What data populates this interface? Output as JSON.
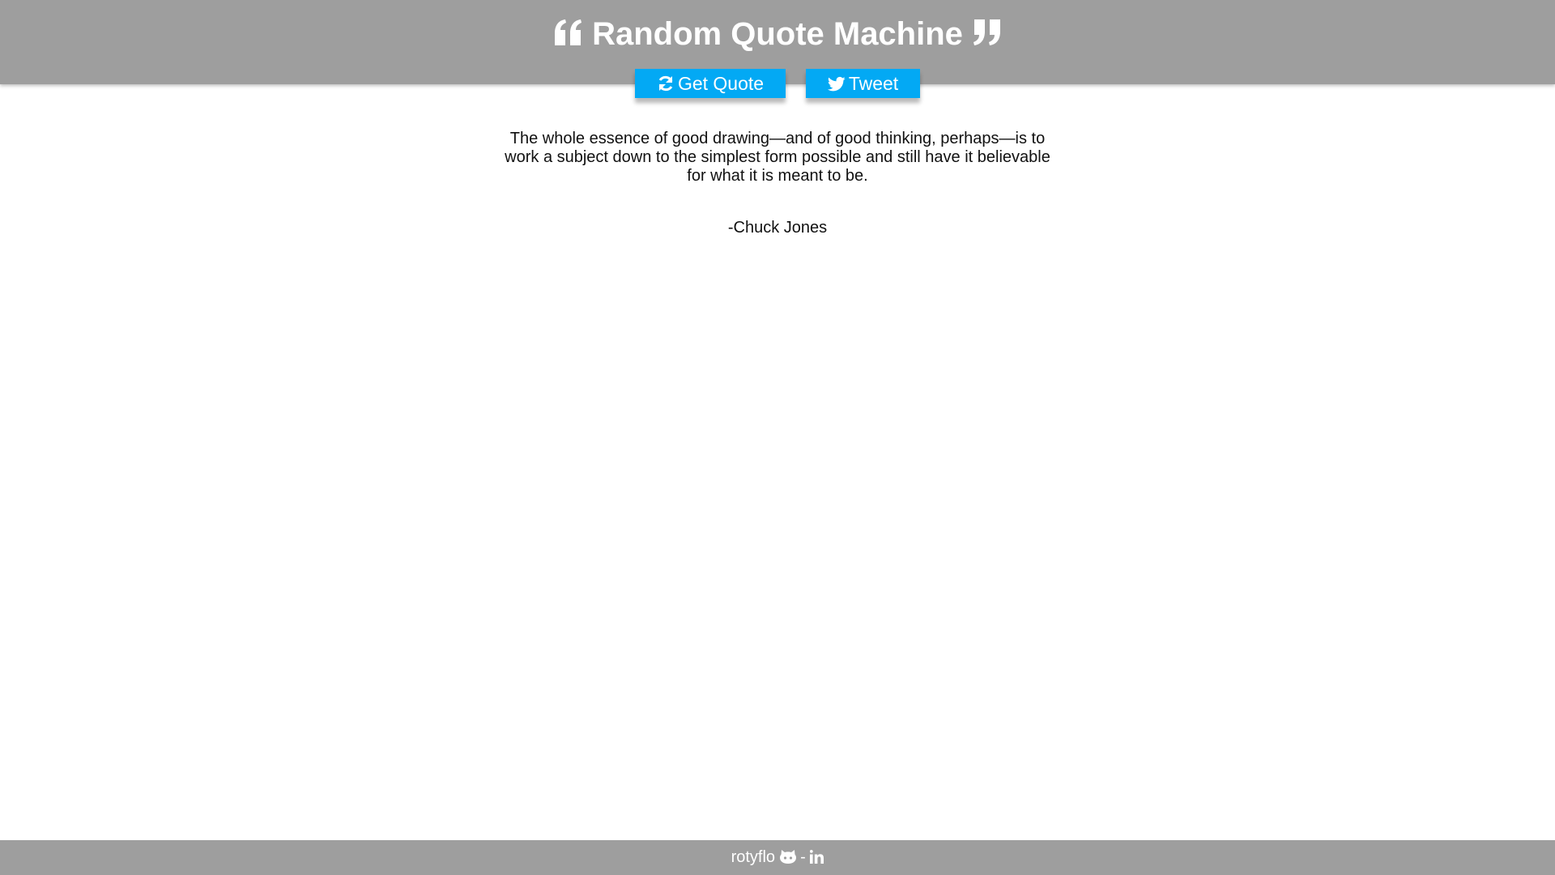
{
  "header": {
    "title": "Random Quote Machine",
    "left_icon": "quote-left-icon",
    "right_icon": "quote-right-icon",
    "background_color": "#9e9e9e"
  },
  "buttons": {
    "get_quote": {
      "label": "Get Quote",
      "icon": "refresh-icon"
    },
    "tweet": {
      "label": "Tweet",
      "icon": "twitter-icon"
    },
    "color": "#03a9f4"
  },
  "quote": {
    "text": "The whole essence of good drawing—and of good thinking, perhaps—is to work a subject down to the simplest form possible and still have it believable for what it is meant to be.",
    "author": "-Chuck Jones"
  },
  "footer": {
    "name": "rotyflo",
    "separator": "-",
    "github_icon": "github-icon",
    "linkedin_icon": "linkedin-icon"
  }
}
